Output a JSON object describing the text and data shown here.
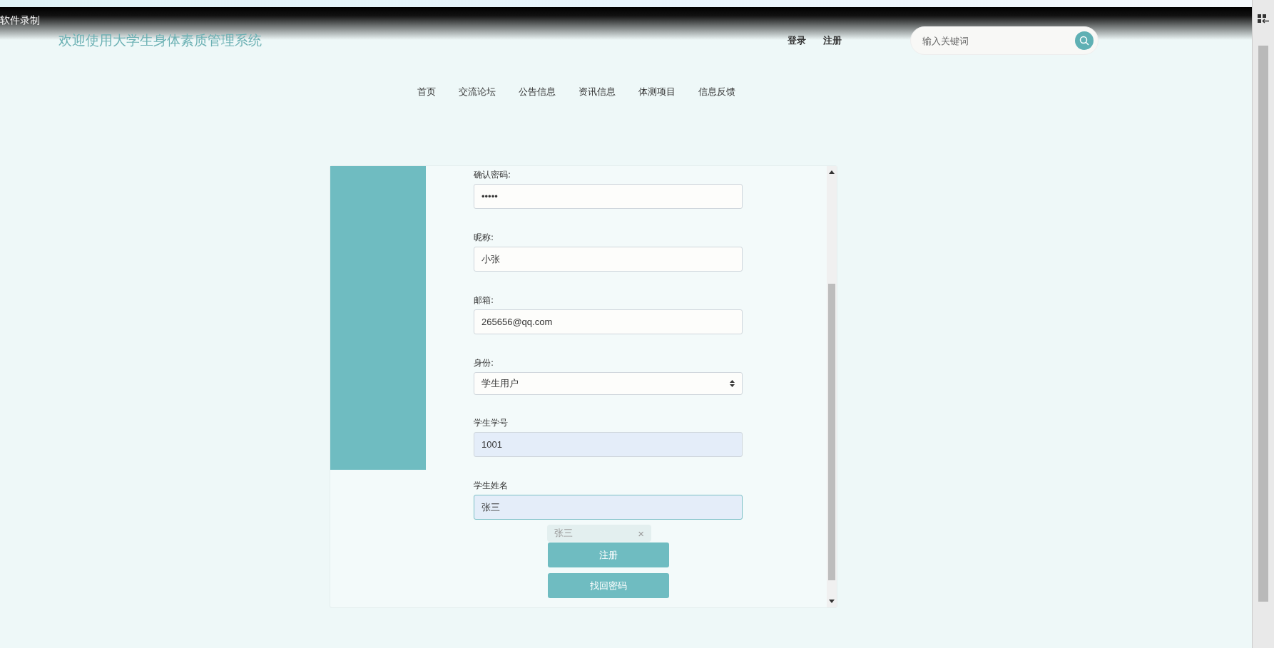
{
  "recorder": {
    "label": "软件录制"
  },
  "header": {
    "title": "欢迎使用大学生身体素质管理系统",
    "auth_links": [
      "登录",
      "注册"
    ],
    "search": {
      "placeholder": "输入关键词"
    }
  },
  "nav": [
    {
      "label": "首页"
    },
    {
      "label": "交流论坛"
    },
    {
      "label": "公告信息"
    },
    {
      "label": "资讯信息"
    },
    {
      "label": "体测项目"
    },
    {
      "label": "信息反馈"
    }
  ],
  "form": {
    "fields": [
      {
        "kind": "password",
        "label": "确认密码:",
        "value": "•••••",
        "focused": false,
        "autofilled": false
      },
      {
        "kind": "text",
        "label": "昵称:",
        "value": "小张",
        "focused": false,
        "autofilled": false
      },
      {
        "kind": "text",
        "label": "邮箱:",
        "value": "265656@qq.com",
        "focused": false,
        "autofilled": false
      },
      {
        "kind": "select",
        "label": "身份:",
        "value": "学生用户",
        "focused": false,
        "autofilled": false
      },
      {
        "kind": "text",
        "label": "学生学号",
        "value": "1001",
        "focused": false,
        "autofilled": true
      },
      {
        "kind": "text",
        "label": "学生姓名",
        "value": "张三",
        "focused": true,
        "autofilled": true
      }
    ],
    "suggestion": {
      "text": "张三",
      "close": "×"
    },
    "buttons": [
      "注册",
      "找回密码"
    ]
  }
}
